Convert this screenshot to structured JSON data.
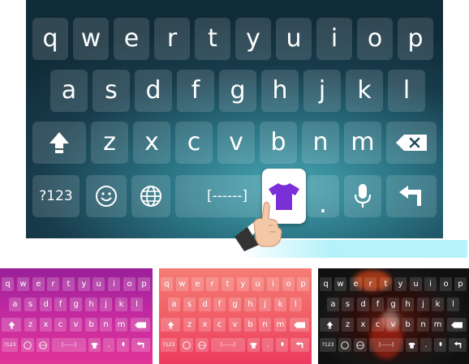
{
  "main_keyboard": {
    "rows": [
      [
        "q",
        "w",
        "e",
        "r",
        "t",
        "y",
        "u",
        "i",
        "o",
        "p"
      ],
      [
        "a",
        "s",
        "d",
        "f",
        "g",
        "h",
        "j",
        "k",
        "l"
      ],
      [
        "z",
        "x",
        "c",
        "v",
        "b",
        "n",
        "m"
      ]
    ],
    "symbols_label": "?123",
    "space_label": "[------]",
    "period_label": ".",
    "colors": {
      "theme_dark": "#112c39",
      "theme_light": "#48a5b3",
      "tshirt": "#7b2fd6",
      "glow": "#8ceaf5"
    },
    "icons": [
      "shift-icon",
      "backspace-icon",
      "smiley-icon",
      "globe-icon",
      "tshirt-icon",
      "microphone-icon",
      "enter-icon",
      "pointing-hand-icon"
    ]
  },
  "themes": [
    {
      "name": "purple",
      "color": "#c42aa0"
    },
    {
      "name": "coral",
      "color": "#f15f66"
    },
    {
      "name": "dark-fire",
      "color": "#161616"
    }
  ],
  "thumb_labels": {
    "rows": [
      [
        "q",
        "w",
        "e",
        "r",
        "t",
        "y",
        "u",
        "i",
        "o",
        "p"
      ],
      [
        "a",
        "s",
        "d",
        "f",
        "g",
        "h",
        "j",
        "k",
        "l"
      ],
      [
        "z",
        "x",
        "c",
        "v",
        "b",
        "n",
        "m"
      ]
    ],
    "symbols": "?123",
    "space": "[------]",
    "period": "."
  }
}
